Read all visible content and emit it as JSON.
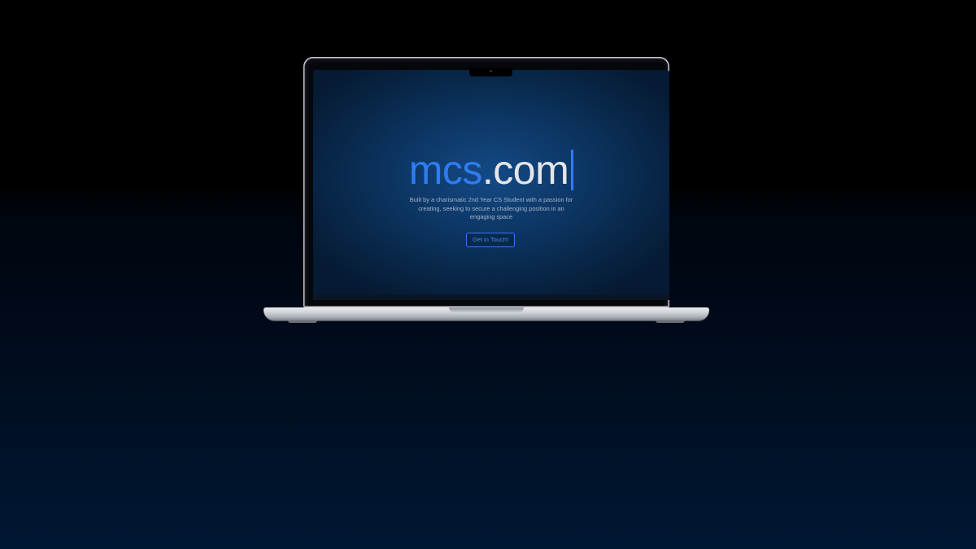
{
  "hero": {
    "title_accent": "mcs",
    "title_main": ".com",
    "subtitle": "Built by a charismatic 2nd Year CS Student with a passion for creating, seeking to secure a challenging position in an engaging space",
    "cta_label": "Get in Touch!"
  },
  "colors": {
    "accent": "#2f7cf0",
    "title_text": "#e4e6ea",
    "subtitle_text": "#a6b4c6",
    "screen_background": "#0d3766",
    "page_background_top": "#000000",
    "page_background_bottom": "#001733"
  }
}
